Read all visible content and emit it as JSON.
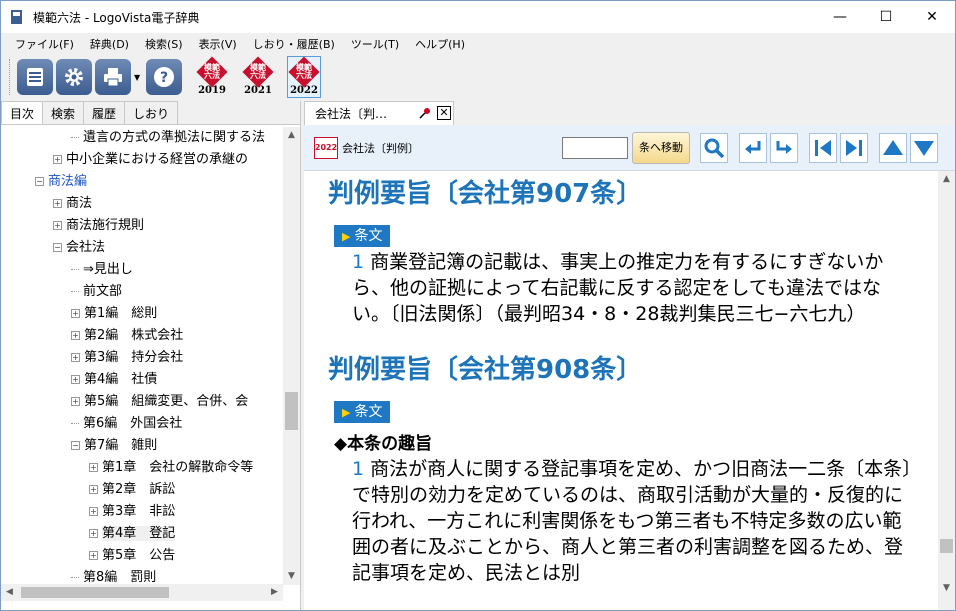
{
  "window": {
    "title": "模範六法 - LogoVista電子辞典",
    "minimize": "—",
    "maximize": "☐",
    "close": "✕"
  },
  "menu": [
    "ファイル(F)",
    "辞典(D)",
    "検索(S)",
    "表示(V)",
    "しおり・履歴(B)",
    "ツール(T)",
    "ヘルプ(H)"
  ],
  "toolbar": {
    "books": [
      {
        "label": "模範六法",
        "year": "2019"
      },
      {
        "label": "模範六法",
        "year": "2021"
      },
      {
        "label": "模範六法",
        "year": "2022"
      }
    ]
  },
  "left_tabs": [
    "目次",
    "検索",
    "履歴",
    "しおり"
  ],
  "tree": [
    {
      "label": "遺言の方式の準拠法に関する法",
      "level": 2,
      "type": "leaf"
    },
    {
      "label": "中小企業における経営の承継の",
      "level": 1,
      "type": "plus"
    },
    {
      "label": "商法編",
      "level": 0,
      "type": "minus",
      "blue": true
    },
    {
      "label": "商法",
      "level": 1,
      "type": "plus"
    },
    {
      "label": "商法施行規則",
      "level": 1,
      "type": "plus"
    },
    {
      "label": "会社法",
      "level": 1,
      "type": "minus"
    },
    {
      "label": "⇒見出し",
      "level": 2,
      "type": "leaf"
    },
    {
      "label": "前文部",
      "level": 2,
      "type": "leaf"
    },
    {
      "label": "第1編　総則",
      "level": 2,
      "type": "plus"
    },
    {
      "label": "第2編　株式会社",
      "level": 2,
      "type": "plus"
    },
    {
      "label": "第3編　持分会社",
      "level": 2,
      "type": "plus"
    },
    {
      "label": "第4編　社債",
      "level": 2,
      "type": "plus"
    },
    {
      "label": "第5編　組織変更、合併、会",
      "level": 2,
      "type": "plus"
    },
    {
      "label": "第6編　外国会社",
      "level": 2,
      "type": "leaf"
    },
    {
      "label": "第7編　雑則",
      "level": 2,
      "type": "minus"
    },
    {
      "label": "第1章　会社の解散命令等",
      "level": 3,
      "type": "plus"
    },
    {
      "label": "第2章　訴訟",
      "level": 3,
      "type": "plus"
    },
    {
      "label": "第3章　非訟",
      "level": 3,
      "type": "plus"
    },
    {
      "label": "第4章　登記",
      "level": 3,
      "type": "plus",
      "selected": true
    },
    {
      "label": "第5章　公告",
      "level": 3,
      "type": "plus"
    },
    {
      "label": "第8編　罰則",
      "level": 2,
      "type": "leaf"
    }
  ],
  "doc_tab": {
    "label": "会社法〔判…",
    "close": "✕"
  },
  "doc_toolbar": {
    "badge": "2022",
    "title": "会社法〔判例〕",
    "jump_label": "条へ移動"
  },
  "content": {
    "sections": [
      {
        "heading": "判例要旨〔会社第907条〕",
        "tag": "条文",
        "subheading": "",
        "para_num": "1",
        "para_text": " 商業登記簿の記載は、事実上の推定力を有するにすぎないから、他の証拠によって右記載に反する認定をしても違法ではない。〔旧法関係〕（最判昭34・8・28裁判集民三七−六七九）"
      },
      {
        "heading": "判例要旨〔会社第908条〕",
        "tag": "条文",
        "subheading": "◆本条の趣旨",
        "para_num": "1",
        "para_text": " 商法が商人に関する登記事項を定め、かつ旧商法一二条〔本条〕で特別の効力を定めているのは、商取引活動が大量的・反復的に行われ、一方これに利害関係をもつ第三者も不特定多数の広い範囲の者に及ぶことから、商人と第三者の利害調整を図るため、登記事項を定め、民法とは別"
      }
    ]
  },
  "colors": {
    "heading": "#1d74b8",
    "tag_bg": "#1e78c3",
    "book_red": "#c8102e"
  }
}
